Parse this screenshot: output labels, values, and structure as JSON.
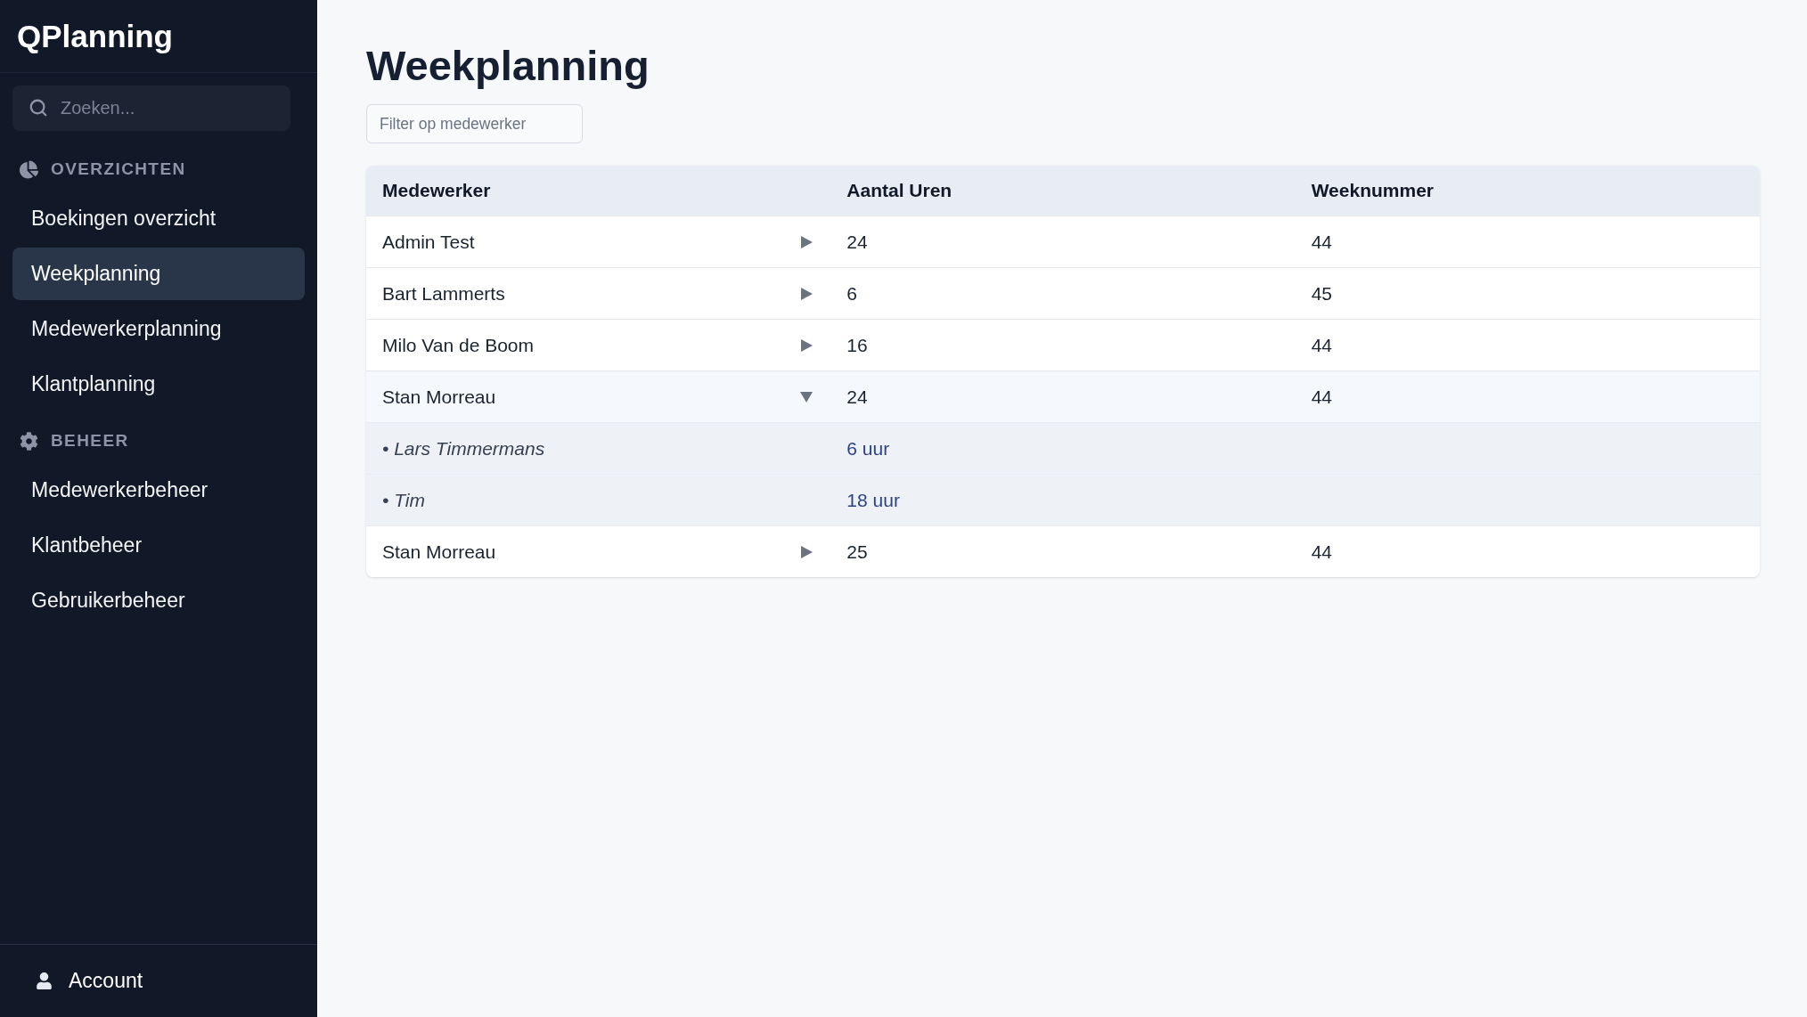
{
  "sidebar": {
    "logo": "QPlanning",
    "search": {
      "placeholder": "Zoeken..."
    },
    "sections": [
      {
        "title": "OVERZICHTEN",
        "items": [
          {
            "label": "Boekingen overzicht",
            "selected": false
          },
          {
            "label": "Weekplanning",
            "selected": true
          },
          {
            "label": "Medewerkerplanning",
            "selected": false
          },
          {
            "label": "Klantplanning",
            "selected": false
          }
        ]
      },
      {
        "title": "BEHEER",
        "items": [
          {
            "label": "Medewerkerbeheer",
            "selected": false
          },
          {
            "label": "Klantbeheer",
            "selected": false
          },
          {
            "label": "Gebruikerbeheer",
            "selected": false
          }
        ]
      }
    ],
    "account": {
      "label": "Account"
    }
  },
  "page": {
    "title": "Weekplanning",
    "filter": {
      "placeholder": "Filter op medewerker"
    }
  },
  "table": {
    "columns": [
      "Medewerker",
      "Aantal Uren",
      "Weeknummer"
    ],
    "rows": [
      {
        "employee": "Admin Test",
        "hours": "24",
        "week": "44",
        "expanded": false
      },
      {
        "employee": "Bart Lammerts",
        "hours": "6",
        "week": "45",
        "expanded": false
      },
      {
        "employee": "Milo Van de Boom",
        "hours": "16",
        "week": "44",
        "expanded": false
      },
      {
        "employee": "Stan Morreau",
        "hours": "24",
        "week": "44",
        "expanded": true,
        "children": [
          {
            "name": "• Lars Timmermans",
            "hours": "6 uur"
          },
          {
            "name": "• Tim",
            "hours": "18 uur"
          }
        ]
      },
      {
        "employee": "Stan Morreau",
        "hours": "25",
        "week": "44",
        "expanded": false
      }
    ]
  }
}
